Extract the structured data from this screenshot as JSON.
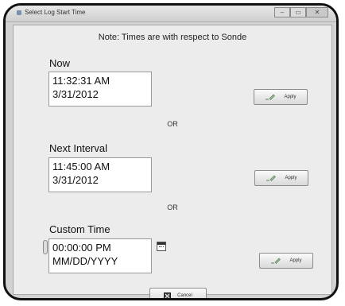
{
  "window": {
    "title": "Select Log Start Time",
    "minimize_glyph": "–",
    "maximize_glyph": "▭",
    "close_glyph": "✕"
  },
  "note": "Note: Times are with respect to Sonde",
  "now": {
    "label": "Now",
    "time": "11:32:31 AM",
    "date": "3/31/2012",
    "apply_label": "Apply"
  },
  "or_text": "OR",
  "next_interval": {
    "label": "Next Interval",
    "time": "11:45:00 AM",
    "date": "3/31/2012",
    "apply_label": "Apply"
  },
  "custom_time": {
    "label": "Custom Time",
    "time": "00:00:00 PM",
    "date": "MM/DD/YYYY",
    "apply_label": "Apply",
    "calendar_icon": "calendar-icon"
  },
  "cancel_label": "Cancel",
  "icons": {
    "apply": "pen-check-icon",
    "cancel": "close-box-icon"
  }
}
